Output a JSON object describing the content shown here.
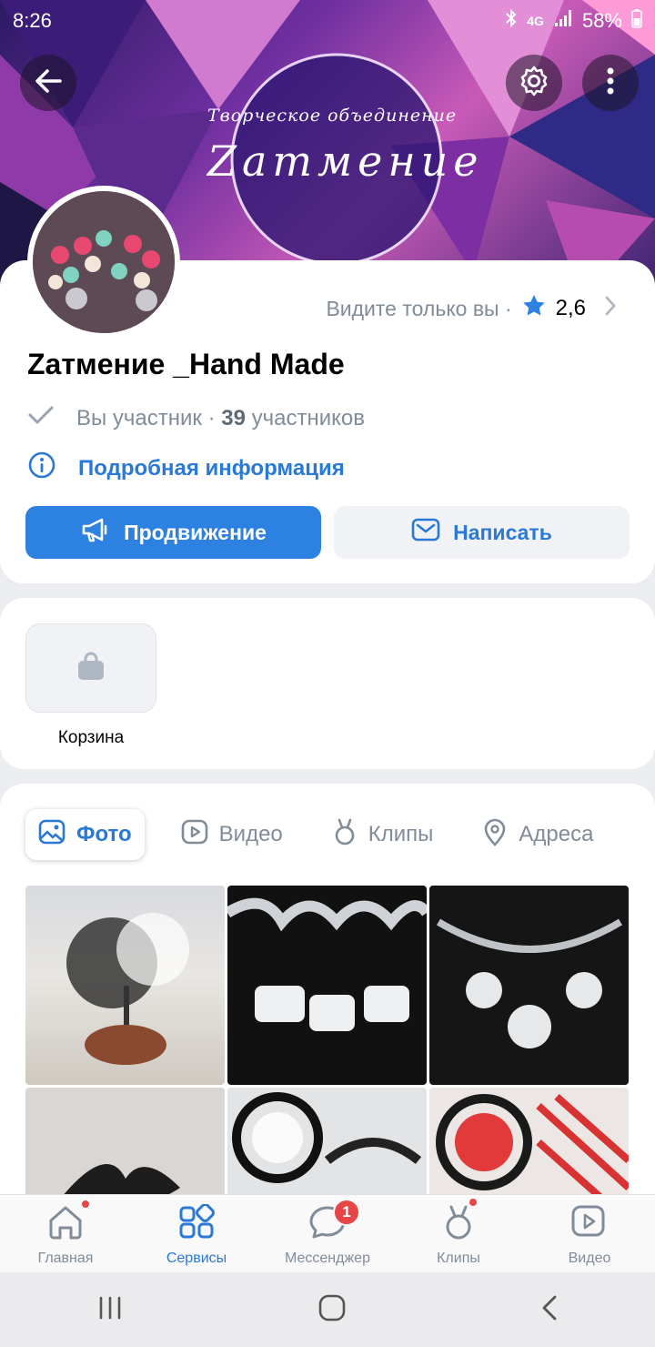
{
  "status_bar": {
    "time": "8:26",
    "signal": "4G",
    "battery": "58%"
  },
  "cover": {
    "subtitle": "Творческое объединение",
    "title": "Zатмение"
  },
  "header": {
    "visibility_text": "Видите только вы ·",
    "rating": "2,6",
    "group_name": "Zатмение _Hand Made",
    "membership": "Вы участник ·",
    "members_count": "39",
    "members_word": "участников",
    "info_link": "Подробная информация",
    "promote_label": "Продвижение",
    "write_label": "Написать"
  },
  "services": {
    "cart_label": "Корзина"
  },
  "media_tabs": [
    {
      "label": "Фото",
      "icon": "image-icon",
      "active": true
    },
    {
      "label": "Видео",
      "icon": "video-icon",
      "active": false
    },
    {
      "label": "Клипы",
      "icon": "clips-icon",
      "active": false
    },
    {
      "label": "Адреса",
      "icon": "location-icon",
      "active": false
    }
  ],
  "bottom_nav": [
    {
      "label": "Главная",
      "icon": "home-icon"
    },
    {
      "label": "Сервисы",
      "icon": "services-icon"
    },
    {
      "label": "Мессенджер",
      "icon": "messenger-icon",
      "badge": "1"
    },
    {
      "label": "Клипы",
      "icon": "clips-icon"
    },
    {
      "label": "Видео",
      "icon": "video-icon"
    }
  ],
  "colors": {
    "accent": "#2d81e0",
    "link": "#2b79d6",
    "secondary_text": "#818c99",
    "badge": "#e64646"
  }
}
